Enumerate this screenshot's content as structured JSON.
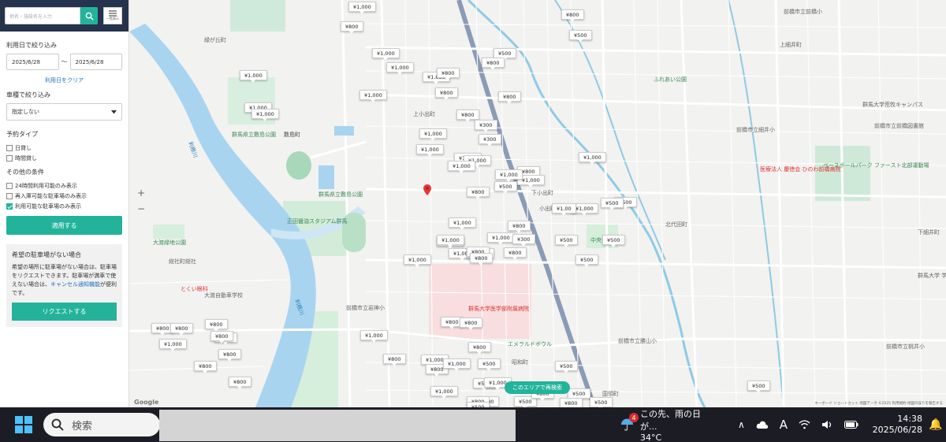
{
  "sidebar": {
    "search_placeholder": "地名・施設名を入力",
    "list_button_label": "一覧表示",
    "date_filter_title": "利用日で絞り込み",
    "date_from": "2025/6/28",
    "date_separator": "〜",
    "date_to": "2025/6/28",
    "clear_date_link": "利用日をクリア",
    "vehicle_filter_title": "車種で絞り込み",
    "vehicle_select_value": "指定しない",
    "reservation_type_title": "予約タイプ",
    "reservation_types": [
      "日貸し",
      "時間貸し"
    ],
    "other_conditions_title": "その他の条件",
    "other_conditions": [
      {
        "label": "24時間利用可能のみ表示",
        "checked": false
      },
      {
        "label": "再入庫可能な駐車場のみ表示",
        "checked": false
      },
      {
        "label": "利用可能な駐車場のみ表示",
        "checked": true
      }
    ],
    "apply_button": "適用する",
    "request_title": "希望の駐車場がない場合",
    "request_text_1": "希望の場所に駐車場がない場合は、駐車場をリクエストできます。駐車場が満車で使えない場合は、",
    "request_link": "キャンセル通知機能",
    "request_text_2": "が便利です。",
    "request_button": "リクエストする"
  },
  "map": {
    "zoom_in": "+",
    "zoom_out": "−",
    "research_button": "このエリアで再検索",
    "google_logo": "Google",
    "attribution": "キーボード ショートカット  地図データ ©2025  利用規約  地図の誤りを報告する",
    "labels": [
      {
        "text": "群馬県立敷島公園",
        "cls": "green"
      },
      {
        "text": "群馬県立敷島公園",
        "cls": "green"
      },
      {
        "text": "数島町",
        "cls": ""
      },
      {
        "text": "正田醤油スタジアム群馬",
        "cls": "green"
      },
      {
        "text": "大渡緑地公園",
        "cls": "green"
      },
      {
        "text": "利根川",
        "cls": "river"
      },
      {
        "text": "利根川",
        "cls": "river"
      },
      {
        "text": "総社町総社",
        "cls": ""
      },
      {
        "text": "とくい眼科",
        "cls": "red"
      },
      {
        "text": "大渡自動車学校",
        "cls": ""
      },
      {
        "text": "前橋市立岩神小",
        "cls": ""
      },
      {
        "text": "群馬大学医学部附属病院",
        "cls": "red"
      },
      {
        "text": "エメラルドボウル",
        "cls": "green"
      },
      {
        "text": "上小出町",
        "cls": ""
      },
      {
        "text": "下小出町",
        "cls": ""
      },
      {
        "text": "小出町",
        "cls": ""
      },
      {
        "text": "中央公園",
        "cls": "green"
      },
      {
        "text": "北代田町",
        "cls": ""
      },
      {
        "text": "前橋市立細井小",
        "cls": ""
      },
      {
        "text": "前橋市立勝山小",
        "cls": ""
      },
      {
        "text": "前橋市立桃井小",
        "cls": ""
      },
      {
        "text": "医療法人 慶徳会 ひのわ前橋病院",
        "cls": "red"
      },
      {
        "text": "ベースボールパーク ファースト北部運動場",
        "cls": "green"
      },
      {
        "text": "前橋市立前橋図書館",
        "cls": ""
      },
      {
        "text": "群馬大学荒牧キャンパス",
        "cls": ""
      },
      {
        "text": "ふれあい公園",
        "cls": "green"
      },
      {
        "text": "上細井町",
        "cls": ""
      },
      {
        "text": "下細井町",
        "cls": ""
      },
      {
        "text": "群馬大学 学部附属",
        "cls": ""
      },
      {
        "text": "昭和町",
        "cls": ""
      },
      {
        "text": "国領町",
        "cls": ""
      },
      {
        "text": "緑が丘町",
        "cls": ""
      },
      {
        "text": "前橋市立前橋小",
        "cls": ""
      },
      {
        "text": "数島町",
        "cls": ""
      }
    ],
    "price_pins": [
      "¥1,000",
      "¥800",
      "¥800",
      "¥500",
      "¥1,000",
      "¥1,000",
      "¥1,000",
      "¥1,000",
      "¥800",
      "¥500",
      "¥800",
      "¥800",
      "¥1,000",
      "¥1,000",
      "¥1,000",
      "¥800",
      "¥800",
      "¥1,000",
      "¥1,000",
      "¥1,000",
      "¥300",
      "¥1,000",
      "¥300",
      "¥1,000",
      "¥800",
      "¥1,000",
      "¥1,000",
      "¥800",
      "¥500",
      "¥1,000",
      "¥1,000",
      "¥1,00",
      "¥500",
      "¥500",
      "¥500",
      "¥1,000",
      "¥800",
      "¥1,000",
      "¥1,000",
      "¥1,000",
      "¥1,000",
      "¥300",
      "¥500",
      "¥1,000",
      "¥800",
      "¥500",
      "¥1,000",
      "¥800",
      "¥800",
      "¥800",
      "¥800",
      "¥800",
      "¥800",
      "¥800",
      "¥800",
      "¥800",
      "¥1,000",
      "¥800",
      "¥800",
      "¥800",
      "¥1,000",
      "¥800",
      "¥1,000",
      "¥800",
      "¥500",
      "¥1,000",
      "¥500",
      "¥800",
      "¥1,000",
      "¥500",
      "¥500",
      "¥500",
      "¥500",
      "¥800",
      "¥800",
      "¥800",
      "¥500",
      "¥1,000",
      "¥500",
      "¥500"
    ]
  },
  "taskbar": {
    "search_label": "検索",
    "weather_badge": "4",
    "weather_title": "この先、雨の日が...",
    "weather_temp": "34°C",
    "clock_time": "14:38",
    "clock_date": "2025/06/28",
    "ime_label": "A"
  }
}
